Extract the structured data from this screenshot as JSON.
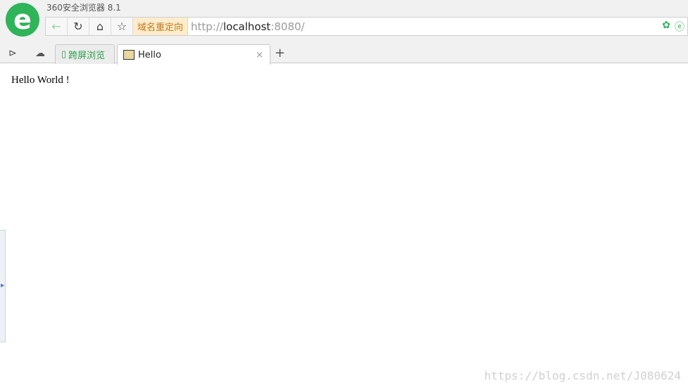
{
  "window": {
    "title": "360安全浏览器 8.1",
    "logo_letter": "e"
  },
  "navbar": {
    "redirect_label": "域名重定向",
    "url_scheme": "http://",
    "url_host": "localhost",
    "url_port": ":8080/"
  },
  "tabs": [
    {
      "label": "跨屏浏览"
    },
    {
      "label": "Hello",
      "close": "×"
    }
  ],
  "content": {
    "text": "Hello World !"
  },
  "watermark": "https://blog.csdn.net/J080624",
  "colors": {
    "accent": "#2fb45a",
    "redirect_bg": "#fdeccd"
  }
}
